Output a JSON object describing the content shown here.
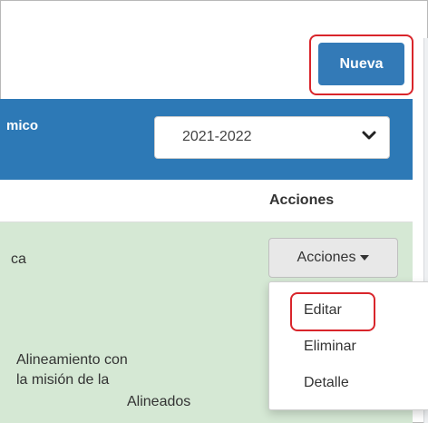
{
  "toolbar": {
    "new_label": "Nueva"
  },
  "filter": {
    "label_fragment": "mico",
    "year_selected": "2021-2022"
  },
  "table": {
    "actions_header": "Acciones",
    "row1_text": "ca",
    "row2_text": "Alineamiento con la misión de la",
    "row2_status": "Alineados"
  },
  "row_actions": {
    "button_label": "Acciones",
    "menu": [
      "Editar",
      "Eliminar",
      "Detalle"
    ]
  },
  "colors": {
    "primary": "#337ab7",
    "header_bar": "#2d79b6",
    "row_highlight": "#d5e8d4",
    "annotation_ring": "#d9252b"
  }
}
